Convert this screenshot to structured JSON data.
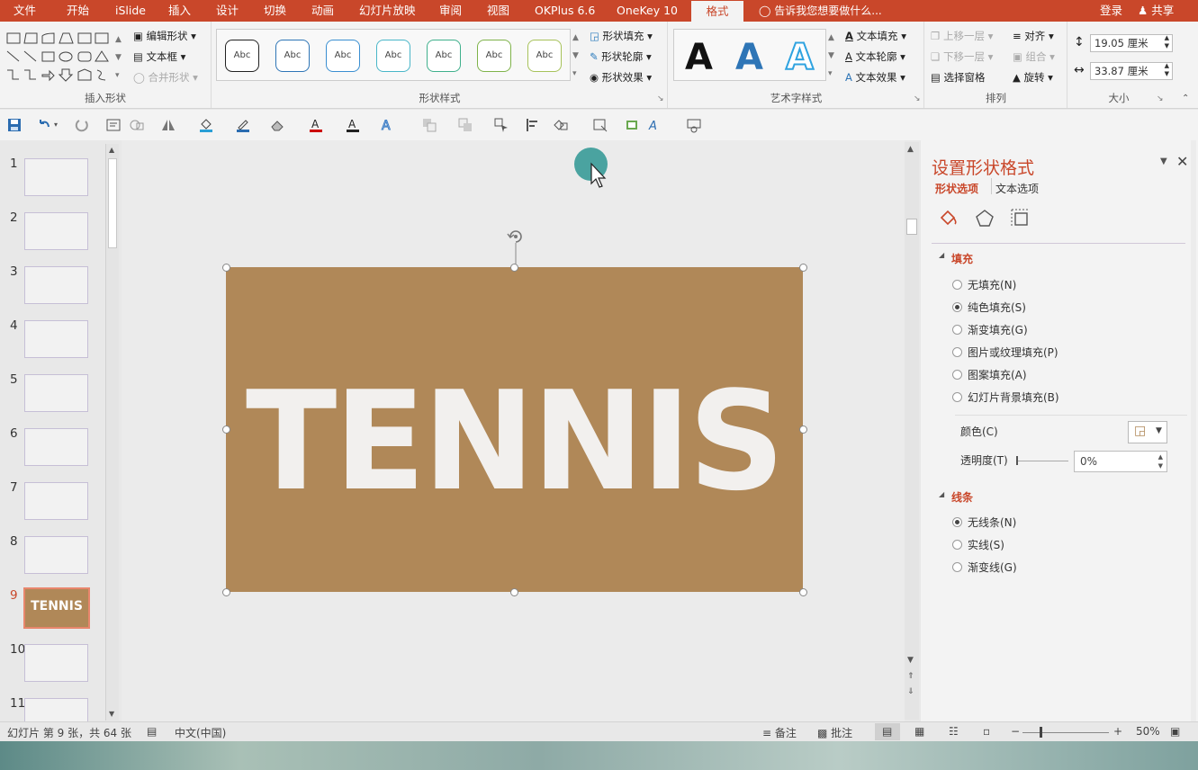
{
  "menu": {
    "items": [
      "文件",
      "开始",
      "iSlide",
      "插入",
      "设计",
      "切换",
      "动画",
      "幻灯片放映",
      "审阅",
      "视图",
      "OKPlus 6.6",
      "OneKey 10",
      "格式"
    ],
    "active": "格式",
    "tell_me": "告诉我您想要做什么...",
    "login": "登录",
    "share": "共享"
  },
  "ribbon": {
    "insert_shape": {
      "label": "插入形状",
      "edit_shape": "编辑形状",
      "textbox": "文本框",
      "merge_shape": "合并形状"
    },
    "shape_styles": {
      "label": "形状样式",
      "samples": [
        "Abc",
        "Abc",
        "Abc",
        "Abc",
        "Abc",
        "Abc",
        "Abc"
      ],
      "fill": "形状填充",
      "outline": "形状轮廓",
      "effect": "形状效果"
    },
    "wordart": {
      "label": "艺术字样式",
      "sample": "A",
      "text_fill": "文本填充",
      "text_outline": "文本轮廓",
      "text_effect": "文本效果"
    },
    "arrange": {
      "label": "排列",
      "bring_forward": "上移一层",
      "send_backward": "下移一层",
      "selection_pane": "选择窗格",
      "align": "对齐",
      "group": "组合",
      "rotate": "旋转"
    },
    "size": {
      "label": "大小",
      "height": "19.05 厘米",
      "width": "33.87 厘米"
    }
  },
  "thumbnails": {
    "numbers": [
      "1",
      "2",
      "3",
      "4",
      "5",
      "6",
      "7",
      "8",
      "9",
      "10",
      "11"
    ],
    "selected_index": 8,
    "selected_text": "TENNIS"
  },
  "slide": {
    "text": "TENNIS",
    "bg_color": "#b08858",
    "text_color": "#f2f0ee"
  },
  "format_pane": {
    "title": "设置形状格式",
    "tab_shape": "形状选项",
    "tab_text": "文本选项",
    "fill_section": "填充",
    "fill_options": [
      "无填充(N)",
      "纯色填充(S)",
      "渐变填充(G)",
      "图片或纹理填充(P)",
      "图案填充(A)",
      "幻灯片背景填充(B)"
    ],
    "fill_selected": 1,
    "color_label": "颜色(C)",
    "transparency_label": "透明度(T)",
    "transparency_value": "0%",
    "line_section": "线条",
    "line_options": [
      "无线条(N)",
      "实线(S)",
      "渐变线(G)"
    ],
    "line_selected": 0
  },
  "status": {
    "slide_info": "幻灯片 第 9 张，共 64 张",
    "language": "中文(中国)",
    "notes": "备注",
    "comments": "批注",
    "zoom": "50%"
  },
  "colors": {
    "accent": "#c9472a",
    "thumb_border": "#e8866c",
    "cursor_circle": "#4aa3a0"
  }
}
